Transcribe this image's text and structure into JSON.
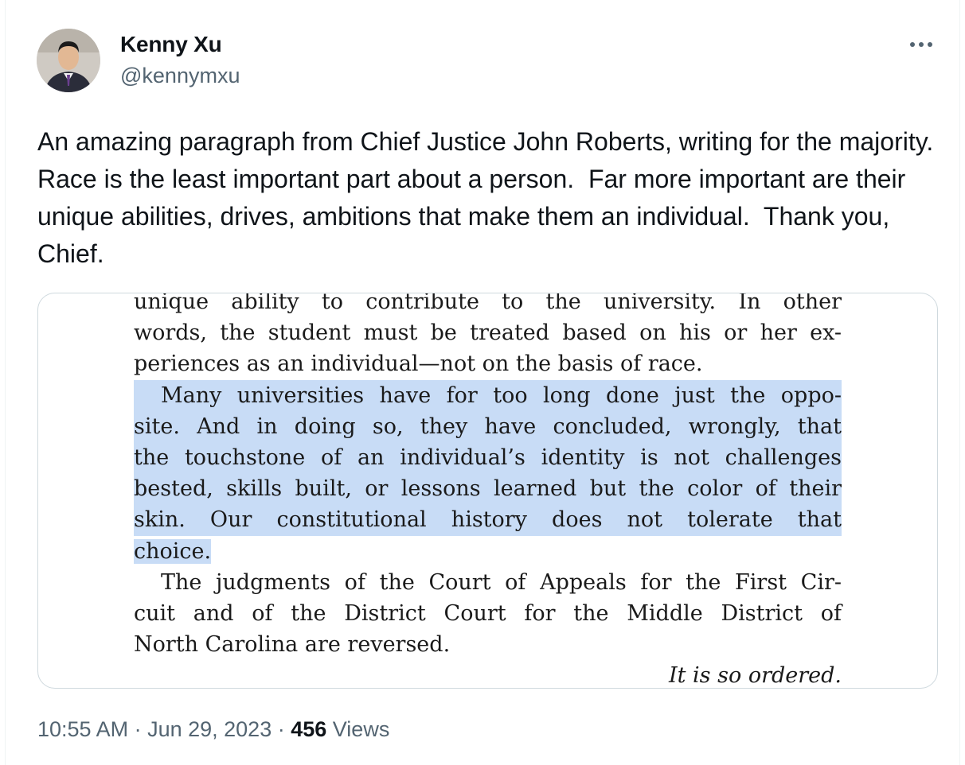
{
  "author": {
    "display_name": "Kenny Xu",
    "handle": "@kennymxu",
    "avatar_icon": "avatar-photo"
  },
  "more_icon": "more-horizontal-icon",
  "tweet_text": "An amazing paragraph from Chief Justice John Roberts, writing for the majority.  Race is the least important part about a person.  Far more important are their unique abilities, drives, ambitions that make them an individual.  Thank you, Chief.",
  "document": {
    "lines": [
      "unique ability to contribute to the university.  In other",
      "words, the student must be treated based on his or her ex-",
      "periences as an individual—not on the basis of race.",
      "Many universities have for too long done just the oppo-",
      "site.  And in doing so, they have concluded, wrongly, that",
      "the touchstone of an individual’s identity is not challenges",
      "bested, skills built, or lessons learned but the color of their",
      "skin.  Our constitutional history does not tolerate that",
      "choice.",
      "The judgments of the Court of Appeals for the First Cir-",
      "cuit and of the District Court for the Middle District of",
      "North Carolina are reversed.",
      "It is so ordered."
    ],
    "highlight_color": "#c8dcf6"
  },
  "meta": {
    "time": "10:55 AM",
    "separator": " · ",
    "date": "Jun 29, 2023",
    "views_count": "456",
    "views_label": " Views"
  },
  "colors": {
    "text_primary": "#0f1419",
    "text_secondary": "#536471",
    "border": "#cfd9de"
  }
}
